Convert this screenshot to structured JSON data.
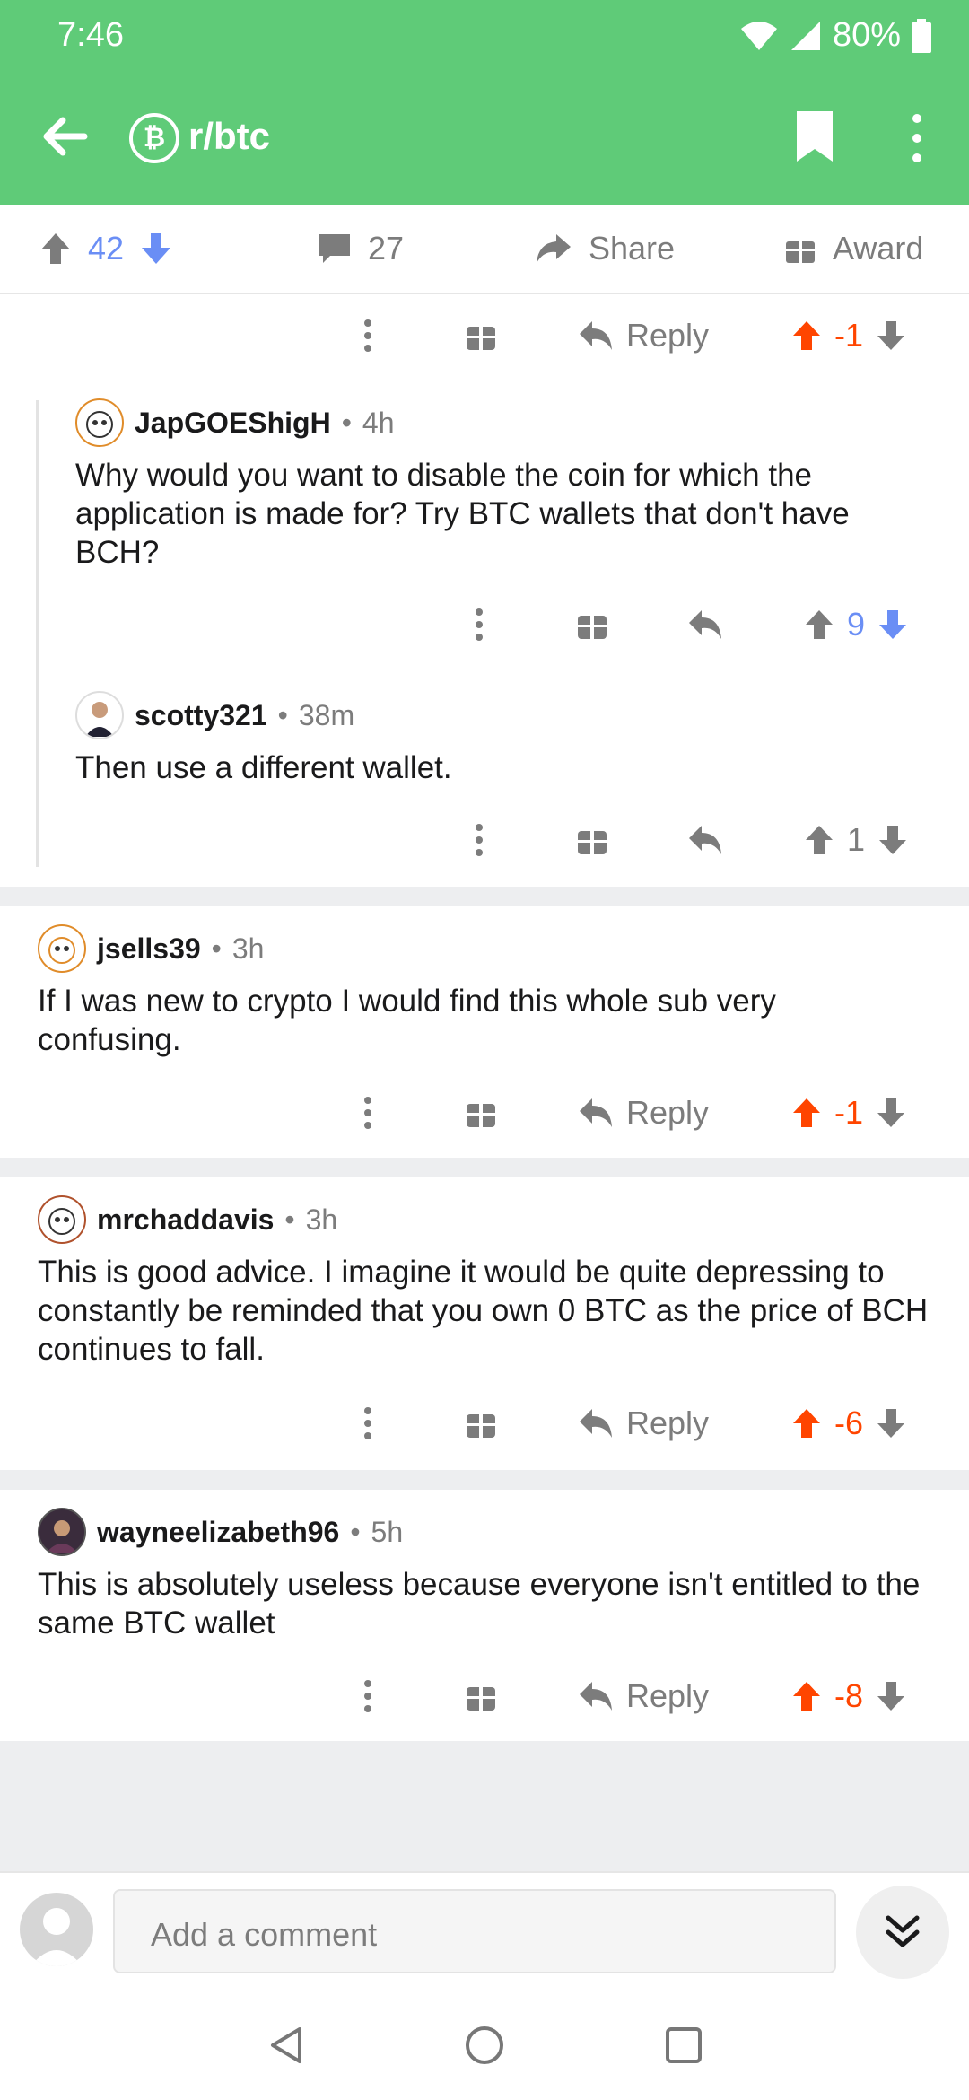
{
  "status_bar": {
    "time": "7:46",
    "battery": "80%"
  },
  "toolbar": {
    "subreddit": "r/btc",
    "subreddit_icon": "bitcoin-icon"
  },
  "post_actions": {
    "score": "42",
    "comments": "27",
    "share": "Share",
    "award": "Award"
  },
  "comments": [
    {
      "id": "c0",
      "actions": {
        "reply": "Reply",
        "score": "-1"
      }
    },
    {
      "id": "c1",
      "author": "JapGOEShigH",
      "time": "4h",
      "body": "Why would you want to disable the coin for which the application is made for? Try BTC wallets that don't have BCH?",
      "actions": {
        "score": "9"
      }
    },
    {
      "id": "c2",
      "author": "scotty321",
      "time": "38m",
      "body": "Then use a different wallet.",
      "actions": {
        "score": "1"
      }
    },
    {
      "id": "c3",
      "author": "jsells39",
      "time": "3h",
      "body": "If I was new to crypto I would find this whole sub very confusing.",
      "actions": {
        "reply": "Reply",
        "score": "-1"
      }
    },
    {
      "id": "c4",
      "author": "mrchaddavis",
      "time": "3h",
      "body": "This is good advice. I imagine it would be quite depressing to constantly be reminded that you own 0 BTC as the price of BCH continues to fall.",
      "actions": {
        "reply": "Reply",
        "score": "-6"
      }
    },
    {
      "id": "c5",
      "author": "wayneelizabeth96",
      "time": "5h",
      "body": "This is absolutely useless because everyone isn't entitled to the same BTC wallet",
      "actions": {
        "reply": "Reply",
        "score": "-8"
      }
    }
  ],
  "composer": {
    "placeholder": "Add a comment"
  },
  "colors": {
    "header": "#5fcb78",
    "upvote": "#ff4500",
    "blue": "#6a8ef5",
    "muted": "#7c7c7c"
  }
}
